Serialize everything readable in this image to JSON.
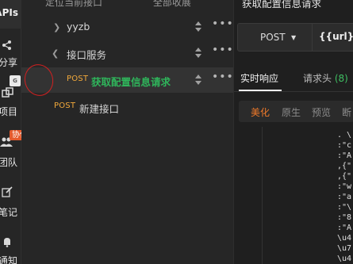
{
  "rail": {
    "apis_label": "APIs",
    "share_label": "分享",
    "project_label": "项目",
    "team_label": "团队",
    "team_badge": "协作",
    "notes_label": "笔记",
    "notify_label": "通知"
  },
  "tree": {
    "top_left": "定位当前接口",
    "top_right": "全部收展",
    "folder1": {
      "name": "yyzb"
    },
    "folder2": {
      "name": "接口服务"
    },
    "item_selected": {
      "method": "POST",
      "name": "获取配置信息请求"
    },
    "item_new": {
      "method": "POST",
      "name": "新建接口"
    },
    "more_glyph": "•••"
  },
  "main": {
    "request_title": "获取配置信息请求",
    "method": "POST",
    "url": "{{url}}",
    "tabs": [
      {
        "label": "实时响应"
      },
      {
        "label": "请求头",
        "count": "(8)"
      }
    ],
    "formats": [
      "美化",
      "原生",
      "预览",
      "断"
    ],
    "code_lines": [
      ". \\",
      ":\"c",
      ":\"A",
      ",{\"",
      ",{\"",
      ":\"w",
      ":\"a",
      ":\"\\",
      ":\"8",
      ":\"A",
      "\\u4",
      "\\u7",
      "\\u4"
    ]
  },
  "colors": {
    "accent_orange": "#f07a2a",
    "method_orange": "#f2a93b",
    "green": "#2fb55b",
    "badge": "#e55b2d",
    "annotation_red": "#d32020"
  }
}
